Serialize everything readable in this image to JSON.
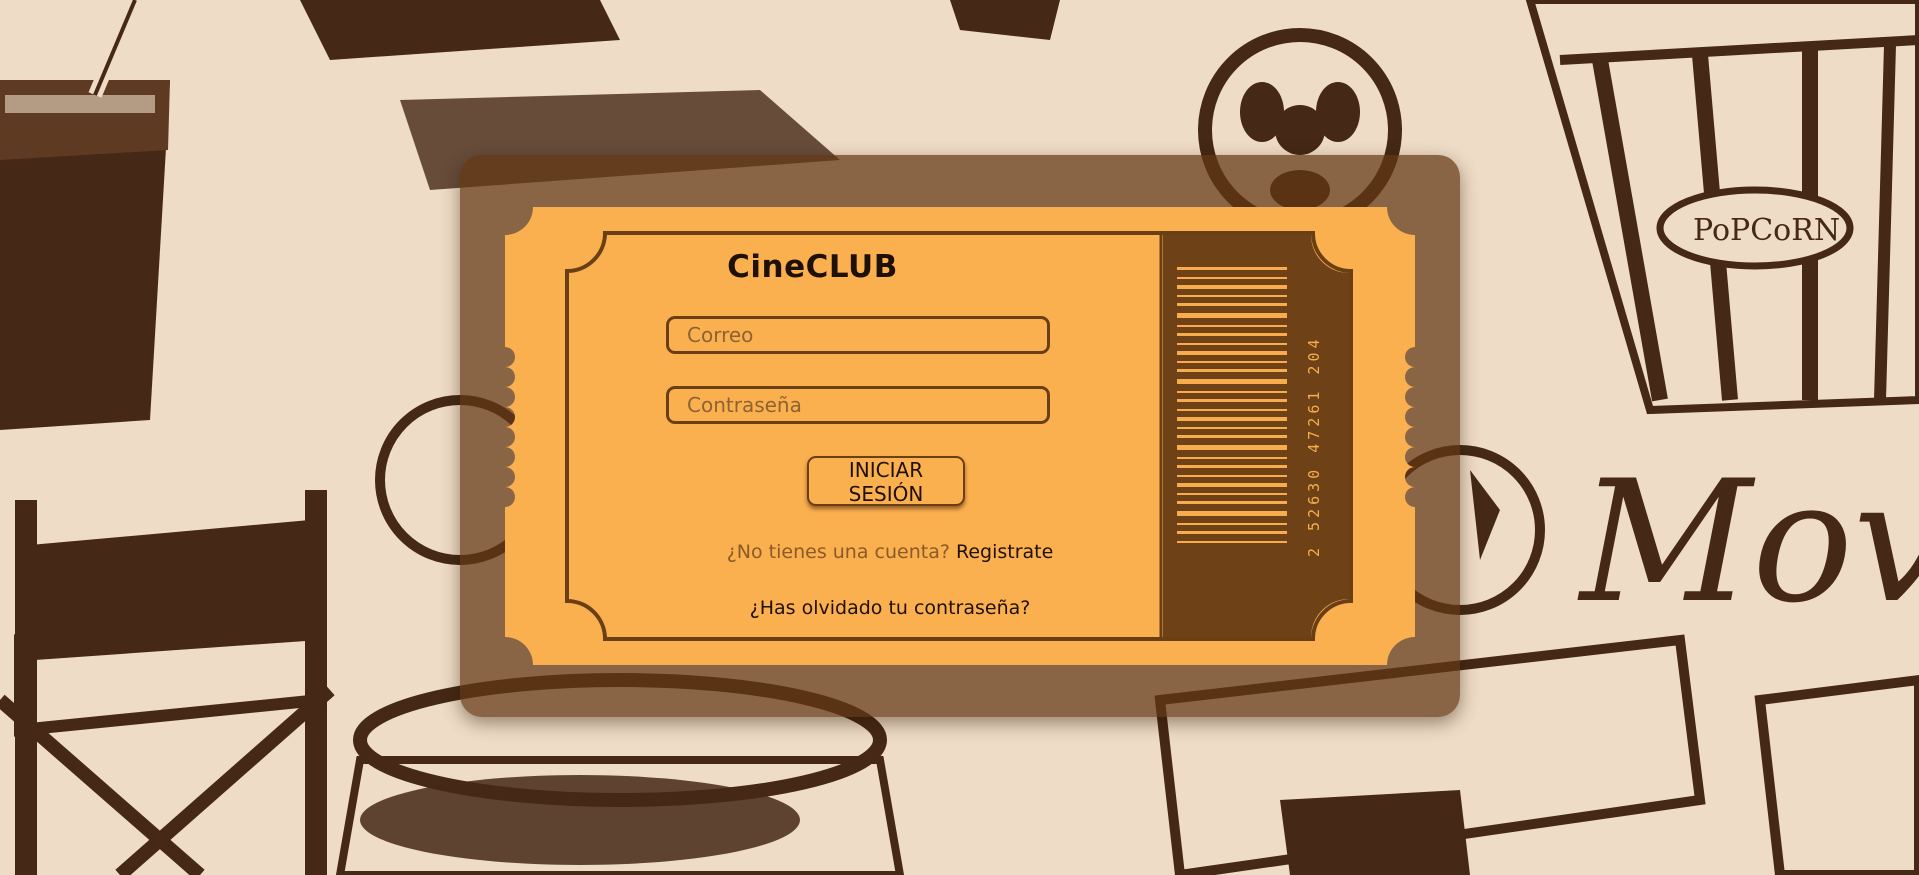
{
  "app": {
    "title": "CineCLUB"
  },
  "login_form": {
    "email_placeholder": "Correo",
    "email_value": "",
    "password_placeholder": "Contraseña",
    "password_value": "",
    "submit_label": "INICIAR SESIÓN",
    "register_question": "¿No tienes una cuenta?",
    "register_link": "Registrate",
    "forgot_password_link": "¿Has olvidado tu contraseña?"
  },
  "ticket": {
    "barcode_number": "2 52630 47261 204"
  },
  "background": {
    "illustration_text": "Movie",
    "popcorn_label": "PoPCoRN"
  },
  "colors": {
    "page_background": "#efdcc6",
    "illustration_ink": "#452816",
    "card_overlay": "#623714",
    "ticket_orange": "#fbb04f",
    "ticket_border": "#6a3f16",
    "stub_dark": "#6e4117",
    "text_dark": "#1f1006",
    "text_muted": "#8a5a28"
  }
}
